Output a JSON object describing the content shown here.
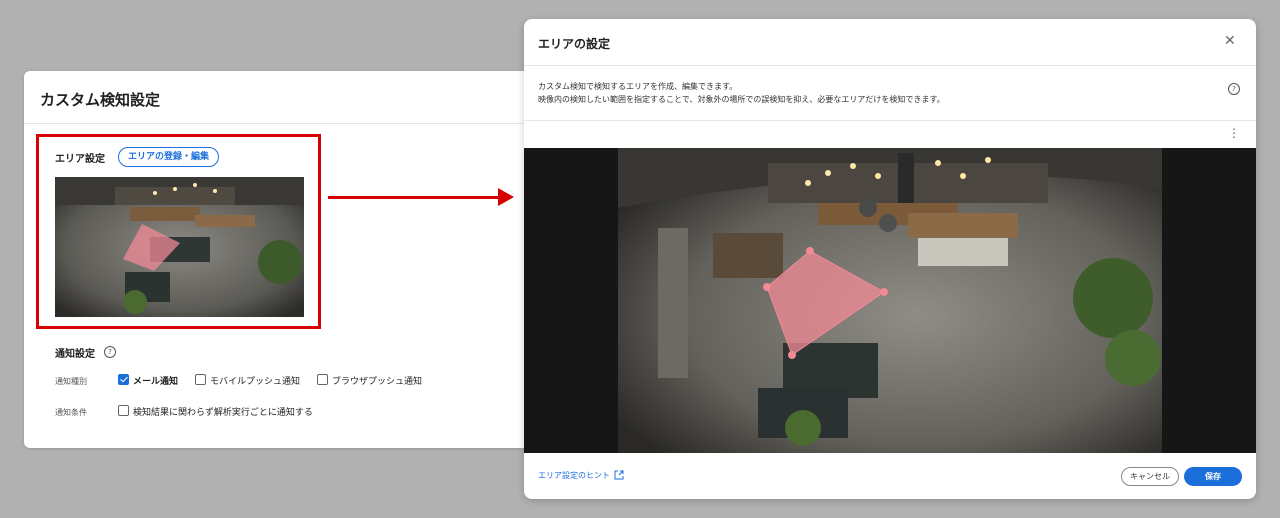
{
  "left_panel": {
    "title": "カスタム検知設定",
    "area_setting_label": "エリア設定",
    "area_edit_button": "エリアの登録・編集",
    "notification_label": "通知設定",
    "notification_type_label": "通知種別",
    "notification_condition_label": "通知条件",
    "options": {
      "mail": {
        "label": "メール通知",
        "checked": true
      },
      "mobile_push": {
        "label": "モバイルプッシュ通知",
        "checked": false
      },
      "browser_push": {
        "label": "ブラウザプッシュ通知",
        "checked": false
      },
      "every_run": {
        "label": "検知結果に関わらず解析実行ごとに通知する",
        "checked": false
      }
    }
  },
  "modal": {
    "title": "エリアの設定",
    "close_icon": "close-icon",
    "description_line1": "カスタム検知で検知するエリアを作成、編集できます。",
    "description_line2": "映像内の検知したい範囲を指定することで、対象外の場所での誤検知を抑え、必要なエリアだけを検知できます。",
    "hint_link": "エリア設定のヒント",
    "cancel_button": "キャンセル",
    "save_button": "保存"
  },
  "colors": {
    "accent": "#1a6fdb",
    "highlight": "#d60000",
    "area_fill": "#f28a96"
  }
}
